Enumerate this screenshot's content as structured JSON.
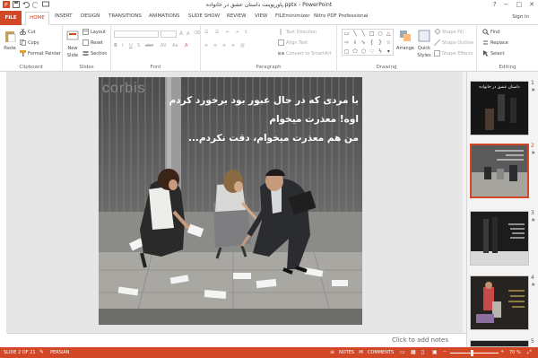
{
  "window": {
    "title": "پاورپوینت داستان عشق در خانواده.pptx - PowerPoint",
    "controls": [
      "?",
      "−",
      "□",
      "✕"
    ]
  },
  "tabs": [
    "FILE",
    "HOME",
    "INSERT",
    "DESIGN",
    "TRANSITIONS",
    "ANIMATIONS",
    "SLIDE SHOW",
    "REVIEW",
    "VIEW",
    "FILEminimizer",
    "Nitro PDF Professional"
  ],
  "account": {
    "sign_in": "Sign in"
  },
  "ribbon": {
    "clipboard": {
      "label": "Clipboard",
      "paste": "Paste",
      "cut": "Cut",
      "copy": "Copy",
      "format_painter": "Format Painter"
    },
    "slides": {
      "label": "Slides",
      "new_slide": "New",
      "new_slide2": "Slide",
      "layout": "Layout",
      "reset": "Reset",
      "section": "Section"
    },
    "font": {
      "label": "Font"
    },
    "paragraph": {
      "label": "Paragraph",
      "text_direction": "Text Direction",
      "align_text": "Align Text",
      "convert_smartart": "Convert to SmartArt"
    },
    "drawing": {
      "label": "Drawing",
      "arrange": "Arrange",
      "quick_styles": "Quick",
      "quick_styles2": "Styles",
      "shape_fill": "Shape Fill",
      "shape_outline": "Shape Outline",
      "shape_effects": "Shape Effects"
    },
    "editing": {
      "label": "Editing",
      "find": "Find",
      "replace": "Replace",
      "select": "Select"
    }
  },
  "slide": {
    "watermark": "corbis",
    "lines": [
      "با مردی که در حال عبور بود برخورد کردم",
      "اوه! معذرت میخوام",
      "من هم معذرت میخوام، دقت نکردم..."
    ]
  },
  "thumbnails": [
    {
      "number": "1",
      "caption": "داستان عشق در خانواده"
    },
    {
      "number": "2",
      "caption": ""
    },
    {
      "number": "3",
      "caption": ""
    },
    {
      "number": "4",
      "caption": ""
    },
    {
      "number": "5",
      "caption": ""
    }
  ],
  "notes": {
    "placeholder": "Click to add notes"
  },
  "status": {
    "slide_info": "SLIDE 2 OF 21",
    "language": "PERSIAN",
    "notes": "NOTES",
    "comments": "COMMENTS",
    "zoom": "70 %"
  },
  "colors": {
    "accent": "#d24726"
  }
}
